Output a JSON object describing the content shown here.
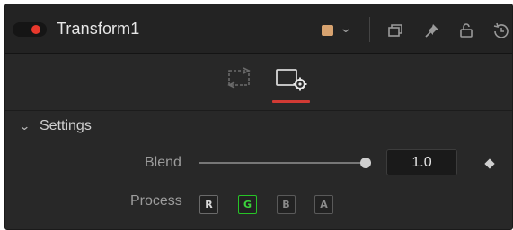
{
  "header": {
    "title": "Transform1",
    "enabled": true,
    "color_swatch": "#d7a26f",
    "icons": [
      "tile-windows-icon",
      "pin-icon",
      "lock-icon",
      "reset-icon"
    ]
  },
  "tabs": [
    {
      "name": "transform-tab-icon",
      "active": false
    },
    {
      "name": "settings-tab-icon",
      "active": true
    }
  ],
  "settings": {
    "section_label": "Settings",
    "blend": {
      "label": "Blend",
      "value": "1.0",
      "slider_fraction": 1.0
    },
    "process": {
      "label": "Process",
      "channels": [
        {
          "label": "R",
          "active": false
        },
        {
          "label": "G",
          "active": true
        },
        {
          "label": "B",
          "active": false
        },
        {
          "label": "A",
          "active": false
        }
      ]
    }
  },
  "colors": {
    "panel_bg": "#282828",
    "toggle_on": "#e8382c",
    "tab_underline": "#d13a34",
    "active_channel": "#27c427"
  }
}
